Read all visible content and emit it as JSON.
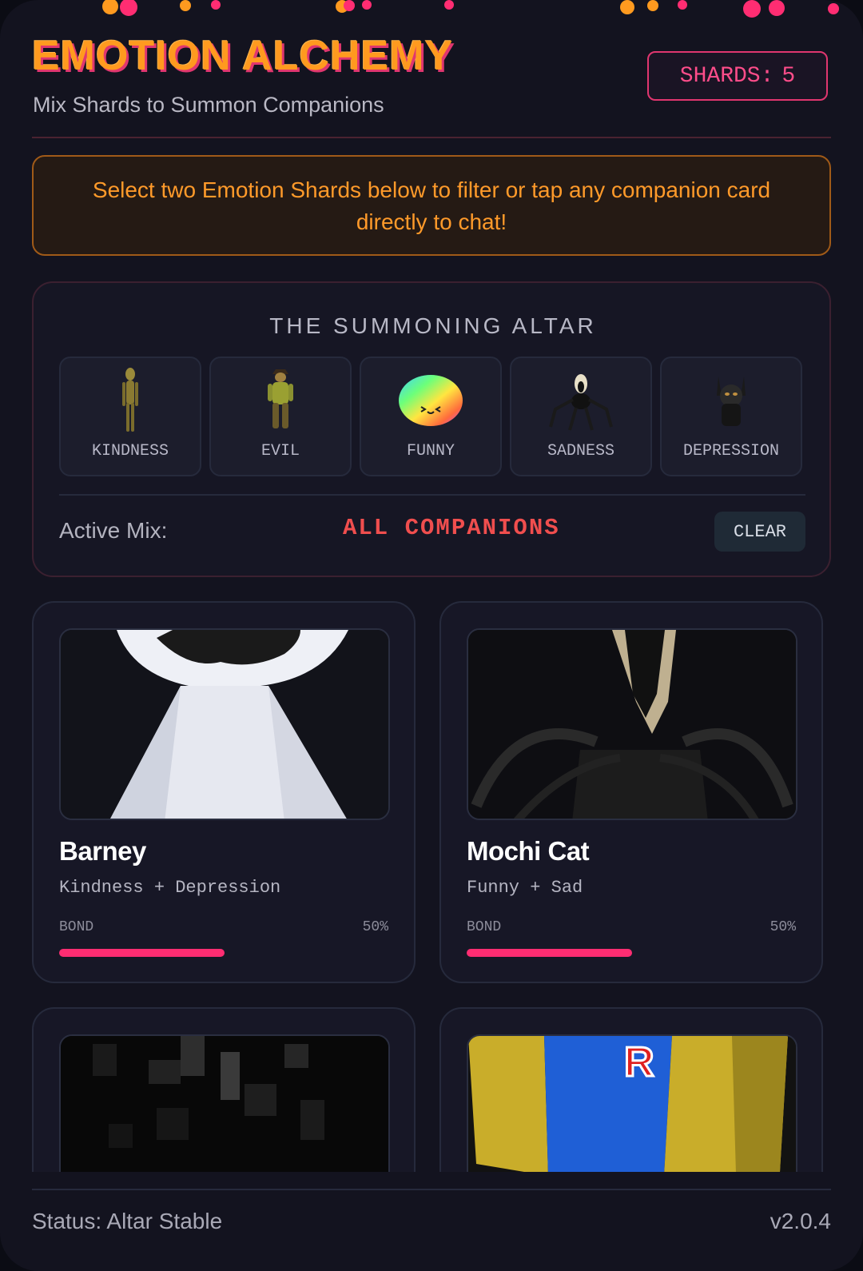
{
  "header": {
    "title": "EMOTION ALCHEMY",
    "subtitle": "Mix Shards to Summon Companions",
    "shards_label": "SHARDS:",
    "shards_count": "5"
  },
  "notice": "Select two Emotion Shards below to filter or tap any companion card directly to chat!",
  "altar": {
    "title": "THE SUMMONING ALTAR",
    "shards": [
      {
        "label": "KINDNESS",
        "icon": "kindness-figure-icon"
      },
      {
        "label": "EVIL",
        "icon": "evil-figure-icon"
      },
      {
        "label": "FUNNY",
        "icon": "rainbow-blob-icon"
      },
      {
        "label": "SADNESS",
        "icon": "spider-figure-icon"
      },
      {
        "label": "DEPRESSION",
        "icon": "shadow-figure-icon"
      }
    ],
    "active_mix_label": "Active Mix:",
    "active_mix_value": "ALL COMPANIONS",
    "clear_label": "CLEAR"
  },
  "companions": [
    {
      "name": "Barney",
      "combo": "Kindness + Depression",
      "bond_label": "BOND",
      "bond_text": "50%",
      "bond": 0.5
    },
    {
      "name": "Mochi Cat",
      "combo": "Funny + Sad",
      "bond_label": "BOND",
      "bond_text": "50%",
      "bond": 0.5
    }
  ],
  "footer": {
    "status": "Status: Altar Stable",
    "version": "v2.0.4"
  },
  "colors": {
    "accent_pink": "#ff2d72",
    "accent_orange": "#ff9a1f",
    "background": "#13131f"
  }
}
